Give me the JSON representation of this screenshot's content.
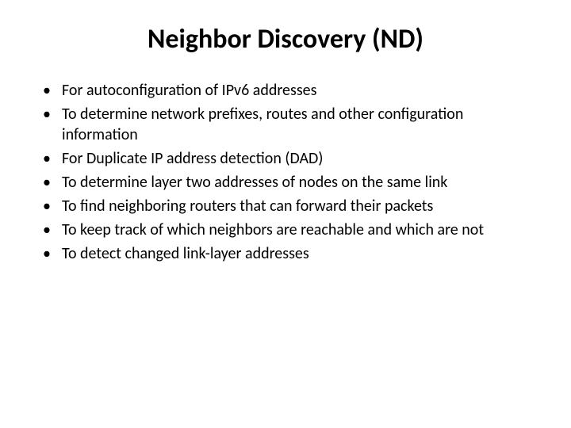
{
  "slide": {
    "title": "Neighbor Discovery (ND)",
    "bullets": [
      "For autoconfiguration of IPv6 addresses",
      "To determine network prefixes, routes and other configuration information",
      "For Duplicate IP address detection (DAD)",
      "To determine layer two addresses of nodes on the same link",
      "To find neighboring routers that can forward their packets",
      "To keep track of which neighbors are reachable and which are not",
      "To detect changed link-layer addresses"
    ]
  }
}
